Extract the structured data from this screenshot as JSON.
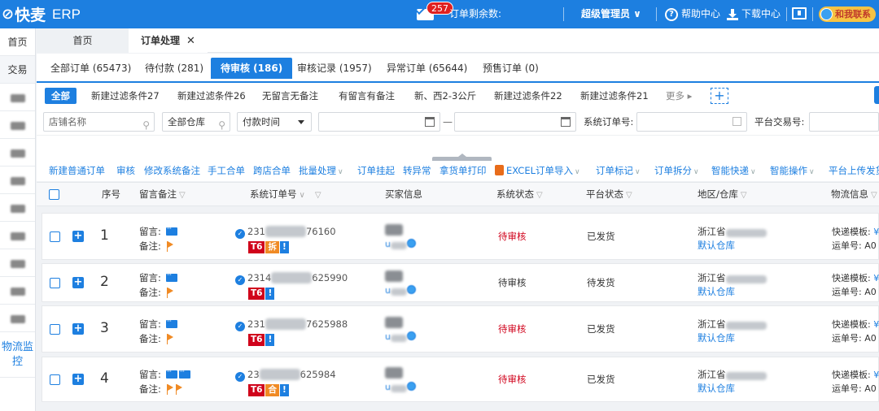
{
  "topbar": {
    "logo_mark": "⊘",
    "logo_text": "快麦",
    "app_title": "ERP",
    "mail_badge": "257",
    "orders_left_label": "订单剩余数:",
    "admin_label": "超级管理员 ∨",
    "help_label": "帮助中心",
    "download_label": "下载中心",
    "contact_label": "和我联系"
  },
  "sidebar": {
    "items": [
      {
        "label": "首页"
      },
      {
        "label": "交易"
      },
      {
        "label": "物流监控"
      }
    ]
  },
  "page_tabs": {
    "home": "首页",
    "order": "订单处理",
    "close": "✕"
  },
  "sub_tabs": [
    {
      "label": "全部订单 (65473)"
    },
    {
      "label": "待付款 (281)"
    },
    {
      "label": "待审核 (186)"
    },
    {
      "label": "审核记录 (1957)"
    },
    {
      "label": "异常订单 (65644)"
    },
    {
      "label": "预售订单 (0)"
    }
  ],
  "filter_chips": [
    {
      "label": "全部"
    },
    {
      "label": "新建过滤条件27"
    },
    {
      "label": "新建过滤条件26"
    },
    {
      "label": "无留言无备注"
    },
    {
      "label": "有留言有备注"
    },
    {
      "label": "新、西2-3公斤"
    },
    {
      "label": "新建过滤条件22"
    },
    {
      "label": "新建过滤条件21"
    },
    {
      "label": "更多 ▸"
    }
  ],
  "search": {
    "shop_placeholder": "店铺名称",
    "warehouse_value": "全部仓库",
    "time_value": "付款时间",
    "system_no_label": "系统订单号:",
    "platform_no_label": "平台交易号:"
  },
  "actions": [
    {
      "label": "新建普通订单",
      "dropdown": false
    },
    {
      "label": "审核",
      "dropdown": false
    },
    {
      "label": "修改系统备注",
      "dropdown": false
    },
    {
      "label": "手工合单",
      "dropdown": false
    },
    {
      "label": "跨店合单",
      "dropdown": false
    },
    {
      "label": "批量处理",
      "dropdown": true
    },
    {
      "label": "订单挂起",
      "dropdown": false
    },
    {
      "label": "转异常",
      "dropdown": false
    },
    {
      "label": "拿货单打印",
      "dropdown": false
    },
    {
      "label": "EXCEL订单导入",
      "dropdown": true
    },
    {
      "label": "订单标记",
      "dropdown": true
    },
    {
      "label": "订单拆分",
      "dropdown": true
    },
    {
      "label": "智能快递",
      "dropdown": true
    },
    {
      "label": "智能操作",
      "dropdown": true
    },
    {
      "label": "平台上传发货",
      "dropdown": false
    }
  ],
  "table": {
    "headers": {
      "seq": "序号",
      "remark": "留言备注",
      "sysno": "系统订单号",
      "buyer": "买家信息",
      "sys_status": "系统状态",
      "platform_status": "平台状态",
      "region": "地区/仓库",
      "logistics": "物流信息"
    },
    "labels": {
      "msg": "留言:",
      "note": "备注:",
      "express_tpl": "快递模板:",
      "waybill": "运单号:",
      "express_tpl_val": "¥",
      "waybill_val": "A0"
    },
    "rows": [
      {
        "seq": "1",
        "sysno_start": "231",
        "sysno_end": "76160",
        "tags": [
          "T6",
          "拆",
          "!"
        ],
        "buyer_nick": "u",
        "status": "待审核",
        "status_red": true,
        "platform_status": "已发货",
        "region": "浙江省",
        "warehouse": "默认仓库",
        "chat_count": 1,
        "flag_count": 1
      },
      {
        "seq": "2",
        "sysno_start": "2314",
        "sysno_end": "625990",
        "tags": [
          "T6",
          "!"
        ],
        "buyer_nick": "u",
        "status": "待审核",
        "status_red": false,
        "platform_status": "待发货",
        "region": "浙江省",
        "warehouse": "默认仓库",
        "chat_count": 1,
        "flag_count": 1
      },
      {
        "seq": "3",
        "sysno_start": "231",
        "sysno_end": "7625988",
        "tags": [
          "T6",
          "!"
        ],
        "buyer_nick": "u",
        "status": "待审核",
        "status_red": true,
        "platform_status": "已发货",
        "region": "浙江省",
        "warehouse": "默认仓库",
        "chat_count": 1,
        "flag_count": 1
      },
      {
        "seq": "4",
        "sysno_start": "23",
        "sysno_end": "625984",
        "tags": [
          "T6",
          "合",
          "!"
        ],
        "buyer_nick": "u",
        "status": "待审核",
        "status_red": true,
        "platform_status": "已发货",
        "region": "浙江省",
        "warehouse": "默认仓库",
        "chat_count": 2,
        "flag_count": 2
      }
    ]
  },
  "colors": {
    "accent": "#1d7fe0",
    "danger": "#d0021b",
    "flag": "#f08a24"
  }
}
